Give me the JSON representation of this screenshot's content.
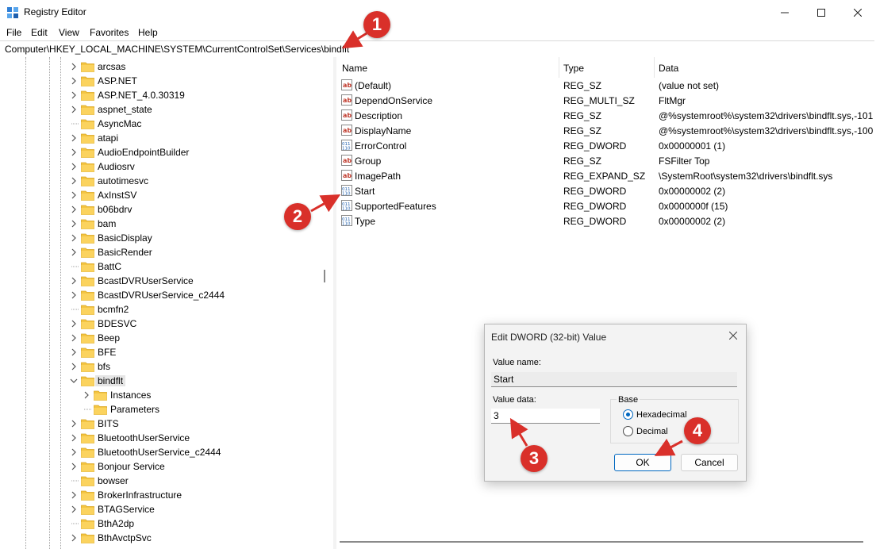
{
  "window": {
    "title": "Registry Editor",
    "minimize_icon": "minimize-icon",
    "maximize_icon": "maximize-icon",
    "close_icon": "close-icon"
  },
  "menu": [
    "File",
    "Edit",
    "View",
    "Favorites",
    "Help"
  ],
  "address": "Computer\\HKEY_LOCAL_MACHINE\\SYSTEM\\CurrentControlSet\\Services\\bindflt",
  "tree": {
    "items": [
      {
        "label": "arcsas",
        "expandable": true
      },
      {
        "label": "ASP.NET",
        "expandable": true
      },
      {
        "label": "ASP.NET_4.0.30319",
        "expandable": true
      },
      {
        "label": "aspnet_state",
        "expandable": true
      },
      {
        "label": "AsyncMac",
        "expandable": false
      },
      {
        "label": "atapi",
        "expandable": true
      },
      {
        "label": "AudioEndpointBuilder",
        "expandable": true
      },
      {
        "label": "Audiosrv",
        "expandable": true
      },
      {
        "label": "autotimesvc",
        "expandable": true
      },
      {
        "label": "AxInstSV",
        "expandable": true
      },
      {
        "label": "b06bdrv",
        "expandable": true
      },
      {
        "label": "bam",
        "expandable": true
      },
      {
        "label": "BasicDisplay",
        "expandable": true
      },
      {
        "label": "BasicRender",
        "expandable": true
      },
      {
        "label": "BattC",
        "expandable": false
      },
      {
        "label": "BcastDVRUserService",
        "expandable": true
      },
      {
        "label": "BcastDVRUserService_c2444",
        "expandable": true
      },
      {
        "label": "bcmfn2",
        "expandable": false
      },
      {
        "label": "BDESVC",
        "expandable": true
      },
      {
        "label": "Beep",
        "expandable": true
      },
      {
        "label": "BFE",
        "expandable": true
      },
      {
        "label": "bfs",
        "expandable": true
      },
      {
        "label": "bindflt",
        "expanded": true,
        "selected": true
      },
      {
        "label": "Instances",
        "child": true,
        "expandable": true
      },
      {
        "label": "Parameters",
        "child": true,
        "expandable": false
      },
      {
        "label": "BITS",
        "expandable": true
      },
      {
        "label": "BluetoothUserService",
        "expandable": true
      },
      {
        "label": "BluetoothUserService_c2444",
        "expandable": true
      },
      {
        "label": "Bonjour Service",
        "expandable": true
      },
      {
        "label": "bowser",
        "expandable": false
      },
      {
        "label": "BrokerInfrastructure",
        "expandable": true
      },
      {
        "label": "BTAGService",
        "expandable": true
      },
      {
        "label": "BthA2dp",
        "expandable": false
      },
      {
        "label": "BthAvctpSvc",
        "expandable": true
      }
    ]
  },
  "list": {
    "headers": {
      "name": "Name",
      "type": "Type",
      "data": "Data"
    },
    "rows": [
      {
        "name": "(Default)",
        "type": "REG_SZ",
        "data": "(value not set)",
        "icon": "string-value-icon"
      },
      {
        "name": "DependOnService",
        "type": "REG_MULTI_SZ",
        "data": "FltMgr",
        "icon": "string-value-icon"
      },
      {
        "name": "Description",
        "type": "REG_SZ",
        "data": "@%systemroot%\\system32\\drivers\\bindflt.sys,-101",
        "icon": "string-value-icon"
      },
      {
        "name": "DisplayName",
        "type": "REG_SZ",
        "data": "@%systemroot%\\system32\\drivers\\bindflt.sys,-100",
        "icon": "string-value-icon"
      },
      {
        "name": "ErrorControl",
        "type": "REG_DWORD",
        "data": "0x00000001 (1)",
        "icon": "binary-value-icon"
      },
      {
        "name": "Group",
        "type": "REG_SZ",
        "data": "FSFilter Top",
        "icon": "string-value-icon"
      },
      {
        "name": "ImagePath",
        "type": "REG_EXPAND_SZ",
        "data": "\\SystemRoot\\system32\\drivers\\bindflt.sys",
        "icon": "string-value-icon"
      },
      {
        "name": "Start",
        "type": "REG_DWORD",
        "data": "0x00000002 (2)",
        "icon": "binary-value-icon"
      },
      {
        "name": "SupportedFeatures",
        "type": "REG_DWORD",
        "data": "0x0000000f (15)",
        "icon": "binary-value-icon"
      },
      {
        "name": "Type",
        "type": "REG_DWORD",
        "data": "0x00000002 (2)",
        "icon": "binary-value-icon"
      }
    ]
  },
  "dialog": {
    "title": "Edit DWORD (32-bit) Value",
    "value_name_label": "Value name:",
    "value_name": "Start",
    "value_data_label": "Value data:",
    "value_data": "3",
    "base_label": "Base",
    "radio_hex": "Hexadecimal",
    "radio_dec": "Decimal",
    "base_selected": "Hexadecimal",
    "ok": "OK",
    "cancel": "Cancel"
  },
  "callouts": [
    "1",
    "2",
    "3",
    "4"
  ],
  "colors": {
    "callout": "#d9302a",
    "folder": "#f4c542",
    "accent": "#0067c0"
  }
}
